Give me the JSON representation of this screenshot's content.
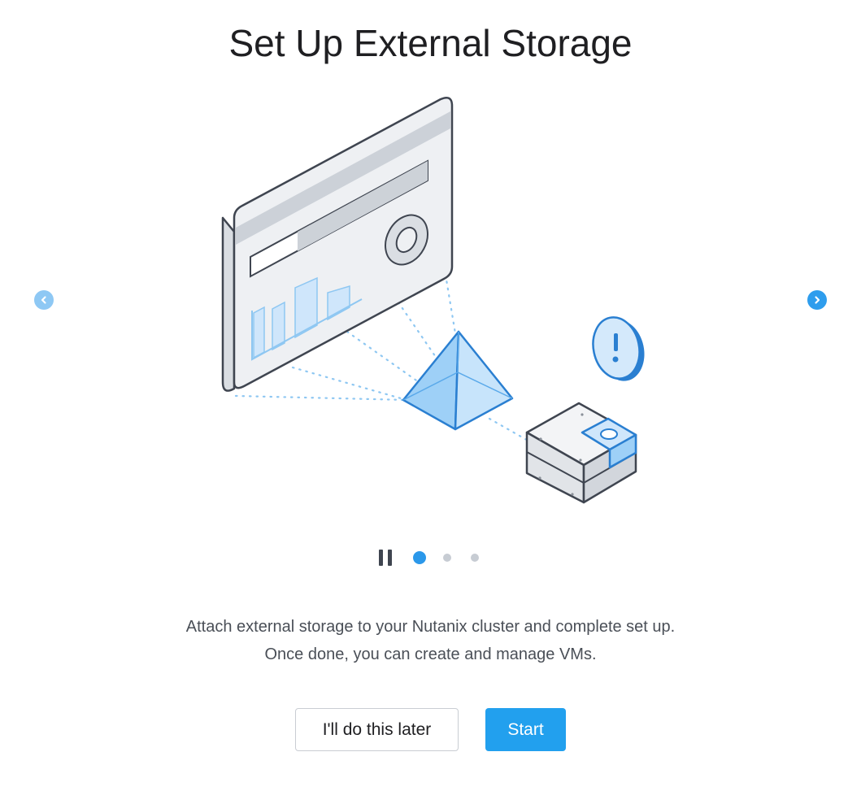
{
  "dialog": {
    "title": "Set Up External Storage",
    "description_line1": "Attach external storage to your Nutanix cluster and complete set up.",
    "description_line2": "Once done, you can create and manage VMs."
  },
  "carousel": {
    "prev_icon": "chevron-left-icon",
    "next_icon": "chevron-right-icon",
    "pause_icon": "pause-icon",
    "slides_count": 3,
    "active_slide": 1
  },
  "buttons": {
    "later_label": "I'll do this later",
    "start_label": "Start"
  },
  "colors": {
    "accent": "#22a0ee",
    "outline": "#3f4550",
    "light_blue": "#cfe6fb",
    "panel": "#eef0f3"
  }
}
